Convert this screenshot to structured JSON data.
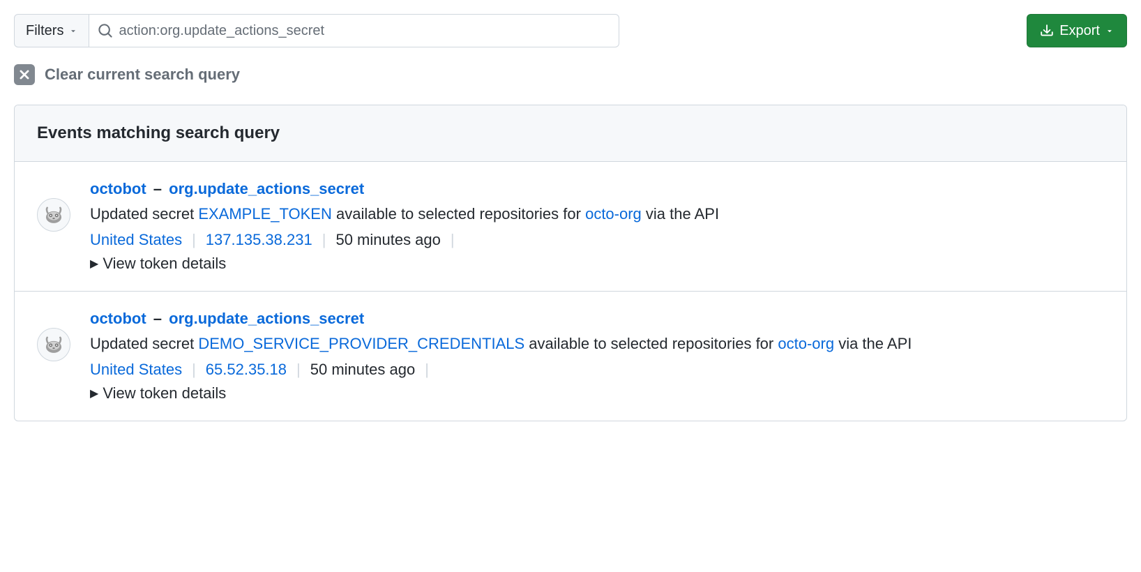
{
  "toolbar": {
    "filters_label": "Filters",
    "search_value": "action:org.update_actions_secret",
    "export_label": "Export"
  },
  "clear": {
    "label": "Clear current search query"
  },
  "panel": {
    "header": "Events matching search query"
  },
  "events": [
    {
      "actor": "octobot",
      "dash": "–",
      "action": "org.update_actions_secret",
      "desc_prefix": "Updated secret ",
      "secret_name": "EXAMPLE_TOKEN",
      "desc_middle": " available to selected repositories for ",
      "org": "octo-org",
      "desc_suffix": " via the API",
      "country": "United States",
      "ip": "137.135.38.231",
      "time": "50 minutes ago",
      "details_label": "View token details"
    },
    {
      "actor": "octobot",
      "dash": "–",
      "action": "org.update_actions_secret",
      "desc_prefix": "Updated secret ",
      "secret_name": "DEMO_SERVICE_PROVIDER_CREDENTIALS",
      "desc_middle": " available to selected repositories for ",
      "org": "octo-org",
      "desc_suffix": " via the API",
      "country": "United States",
      "ip": "65.52.35.18",
      "time": "50 minutes ago",
      "details_label": "View token details"
    }
  ]
}
